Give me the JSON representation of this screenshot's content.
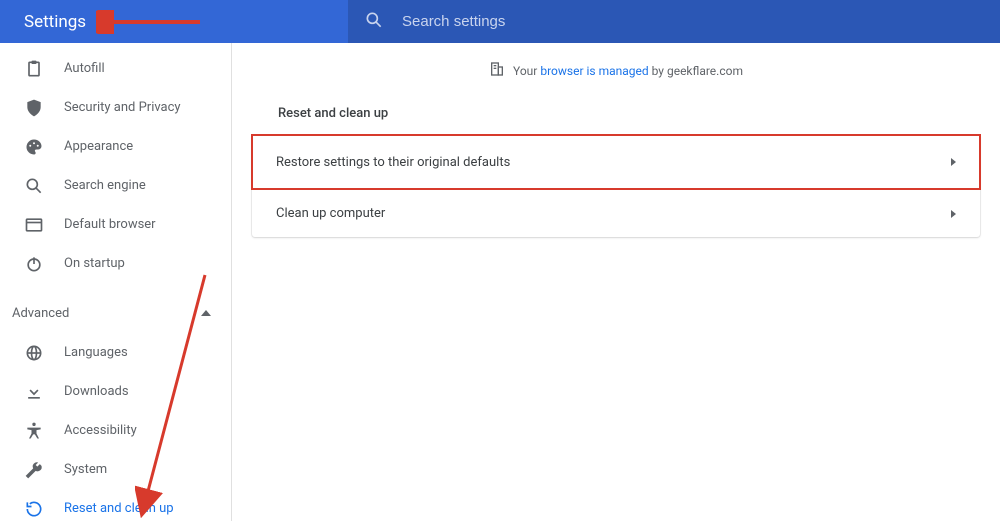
{
  "header": {
    "title": "Settings",
    "search_placeholder": "Search settings"
  },
  "sidebar": {
    "items_top": [
      {
        "label": "Autofill",
        "icon": "clipboard-icon"
      },
      {
        "label": "Security and Privacy",
        "icon": "shield-icon"
      },
      {
        "label": "Appearance",
        "icon": "palette-icon"
      },
      {
        "label": "Search engine",
        "icon": "search-icon"
      },
      {
        "label": "Default browser",
        "icon": "browser-icon"
      },
      {
        "label": "On startup",
        "icon": "power-icon"
      }
    ],
    "advanced_label": "Advanced",
    "items_advanced": [
      {
        "label": "Languages",
        "icon": "globe-icon"
      },
      {
        "label": "Downloads",
        "icon": "download-icon"
      },
      {
        "label": "Accessibility",
        "icon": "accessibility-icon"
      },
      {
        "label": "System",
        "icon": "wrench-icon"
      },
      {
        "label": "Reset and clean up",
        "icon": "restore-icon"
      }
    ]
  },
  "main": {
    "managed_prefix": "Your ",
    "managed_link": "browser is managed",
    "managed_suffix": " by geekflare.com",
    "section_heading": "Reset and clean up",
    "rows": [
      {
        "label": "Restore settings to their original defaults"
      },
      {
        "label": "Clean up computer"
      }
    ]
  }
}
